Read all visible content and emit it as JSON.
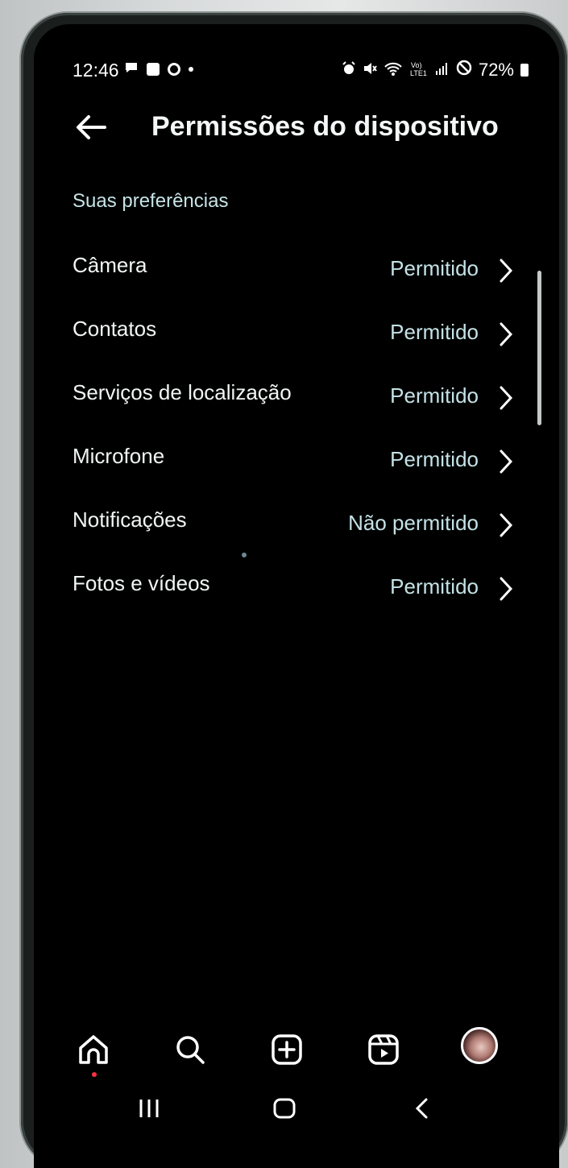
{
  "status_bar": {
    "time": "12:46",
    "battery": "72%",
    "left_icons": [
      "message-icon",
      "checkbox-icon",
      "settings-icon",
      "dot-icon"
    ],
    "right_icons": [
      "alarm-icon",
      "mute-icon",
      "wifi-icon",
      "volte-icon",
      "signal-icon",
      "do-not-disturb-icon",
      "battery-icon"
    ],
    "volte_label": "Vo)\nLTE1"
  },
  "header": {
    "title": "Permissões do dispositivo"
  },
  "section": {
    "label": "Suas preferências"
  },
  "permissions": [
    {
      "label": "Câmera",
      "value": "Permitido"
    },
    {
      "label": "Contatos",
      "value": "Permitido"
    },
    {
      "label": "Serviços de localização",
      "value": "Permitido"
    },
    {
      "label": "Microfone",
      "value": "Permitido"
    },
    {
      "label": "Notificações",
      "value": "Não permitido"
    },
    {
      "label": "Fotos e vídeos",
      "value": "Permitido"
    }
  ],
  "bottom_nav": {
    "items": [
      "home-icon",
      "search-icon",
      "create-icon",
      "reels-icon",
      "profile-avatar"
    ],
    "active": "home-icon"
  },
  "system_nav": [
    "recent-apps-icon",
    "home-button-icon",
    "back-button-icon"
  ],
  "colors": {
    "background": "#000000",
    "text_primary": "#f2f5f5",
    "text_secondary": "#c4e2e6",
    "notification_dot": "#ff3040"
  }
}
